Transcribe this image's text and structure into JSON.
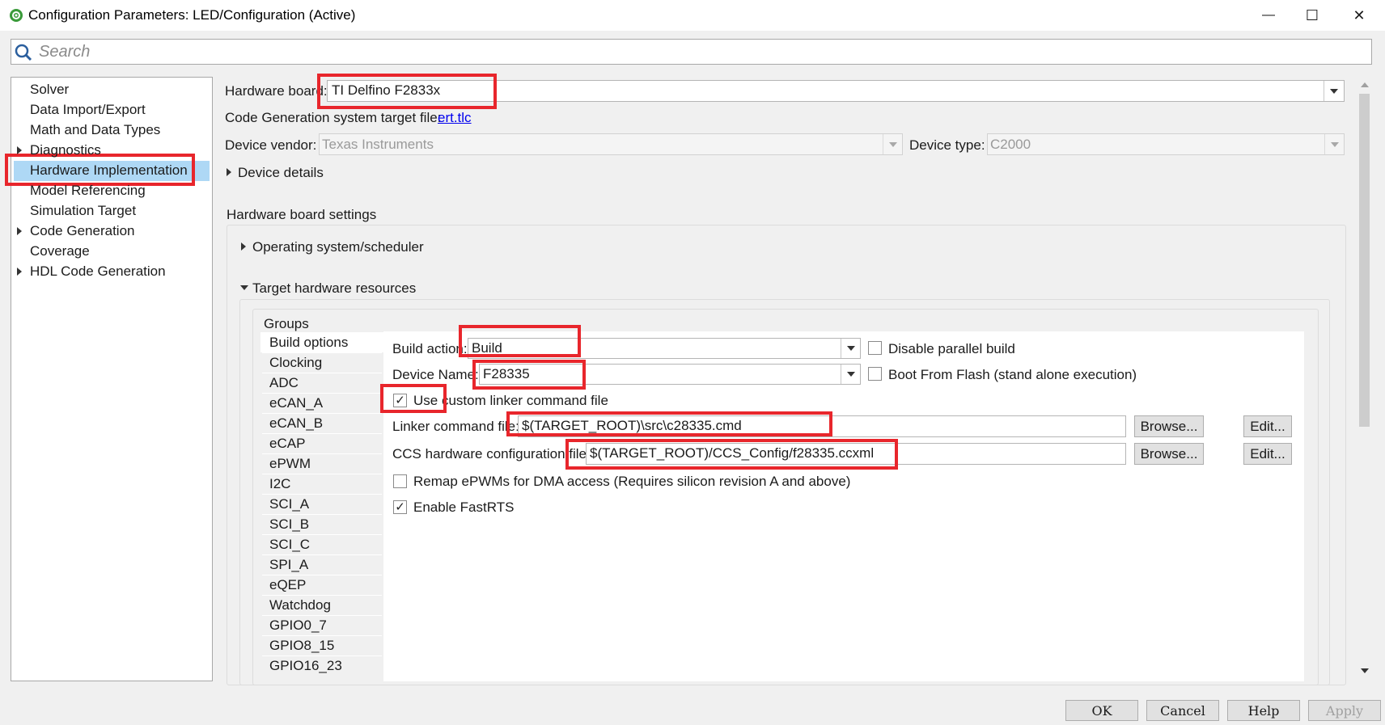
{
  "window": {
    "title": "Configuration Parameters: LED/Configuration (Active)",
    "minimize_glyph": "—",
    "maximize_glyph": "☐",
    "close_glyph": "✕"
  },
  "search": {
    "placeholder": "Search"
  },
  "nav": {
    "items": [
      {
        "label": "Solver",
        "expandable": false
      },
      {
        "label": "Data Import/Export",
        "expandable": false
      },
      {
        "label": "Math and Data Types",
        "expandable": false
      },
      {
        "label": "Diagnostics",
        "expandable": true
      },
      {
        "label": "Hardware Implementation",
        "expandable": false,
        "selected": true
      },
      {
        "label": "Model Referencing",
        "expandable": false
      },
      {
        "label": "Simulation Target",
        "expandable": false
      },
      {
        "label": "Code Generation",
        "expandable": true
      },
      {
        "label": "Coverage",
        "expandable": false
      },
      {
        "label": "HDL Code Generation",
        "expandable": true
      }
    ]
  },
  "main": {
    "hardware_board_label": "Hardware board:",
    "hardware_board_value": "TI Delfino F2833x",
    "codegen_label": "Code Generation system target file:",
    "codegen_link": "ert.tlc",
    "device_vendor_label": "Device vendor:",
    "device_vendor_value": "Texas Instruments",
    "device_type_label": "Device type:",
    "device_type_value": "C2000",
    "device_details_label": "Device details",
    "board_settings_label": "Hardware board settings",
    "os_scheduler_label": "Operating system/scheduler",
    "target_resources_label": "Target hardware resources",
    "groups_label": "Groups",
    "groups": [
      "Build options",
      "Clocking",
      "ADC",
      "eCAN_A",
      "eCAN_B",
      "eCAP",
      "ePWM",
      "I2C",
      "SCI_A",
      "SCI_B",
      "SCI_C",
      "SPI_A",
      "eQEP",
      "Watchdog",
      "GPIO0_7",
      "GPIO8_15",
      "GPIO16_23"
    ],
    "build_action_label": "Build action:",
    "build_action_value": "Build",
    "disable_parallel_label": "Disable parallel build",
    "disable_parallel_checked": false,
    "device_name_label": "Device Name:",
    "device_name_value": "F28335",
    "boot_flash_label": "Boot From Flash (stand alone execution)",
    "boot_flash_checked": false,
    "use_custom_linker_label": "Use custom linker command file",
    "use_custom_linker_checked": true,
    "linker_file_label": "Linker command file:",
    "linker_file_value": "$(TARGET_ROOT)\\src\\c28335.cmd",
    "ccs_config_label": "CCS hardware configuration file:",
    "ccs_config_value": "$(TARGET_ROOT)/CCS_Config/f28335.ccxml",
    "browse_label": "Browse...",
    "edit_label": "Edit...",
    "remap_epwm_label": "Remap ePWMs for DMA access (Requires silicon revision A and above)",
    "remap_epwm_checked": false,
    "fastrts_label": "Enable FastRTS",
    "fastrts_checked": true,
    "check_glyph": "✓"
  },
  "footer": {
    "ok_label": "OK",
    "cancel_label": "Cancel",
    "help_label": "Help",
    "apply_label": "Apply"
  },
  "colors": {
    "highlight_red": "#e8262c",
    "nav_selected": "#aed8f5",
    "link_blue": "#0000ee"
  }
}
